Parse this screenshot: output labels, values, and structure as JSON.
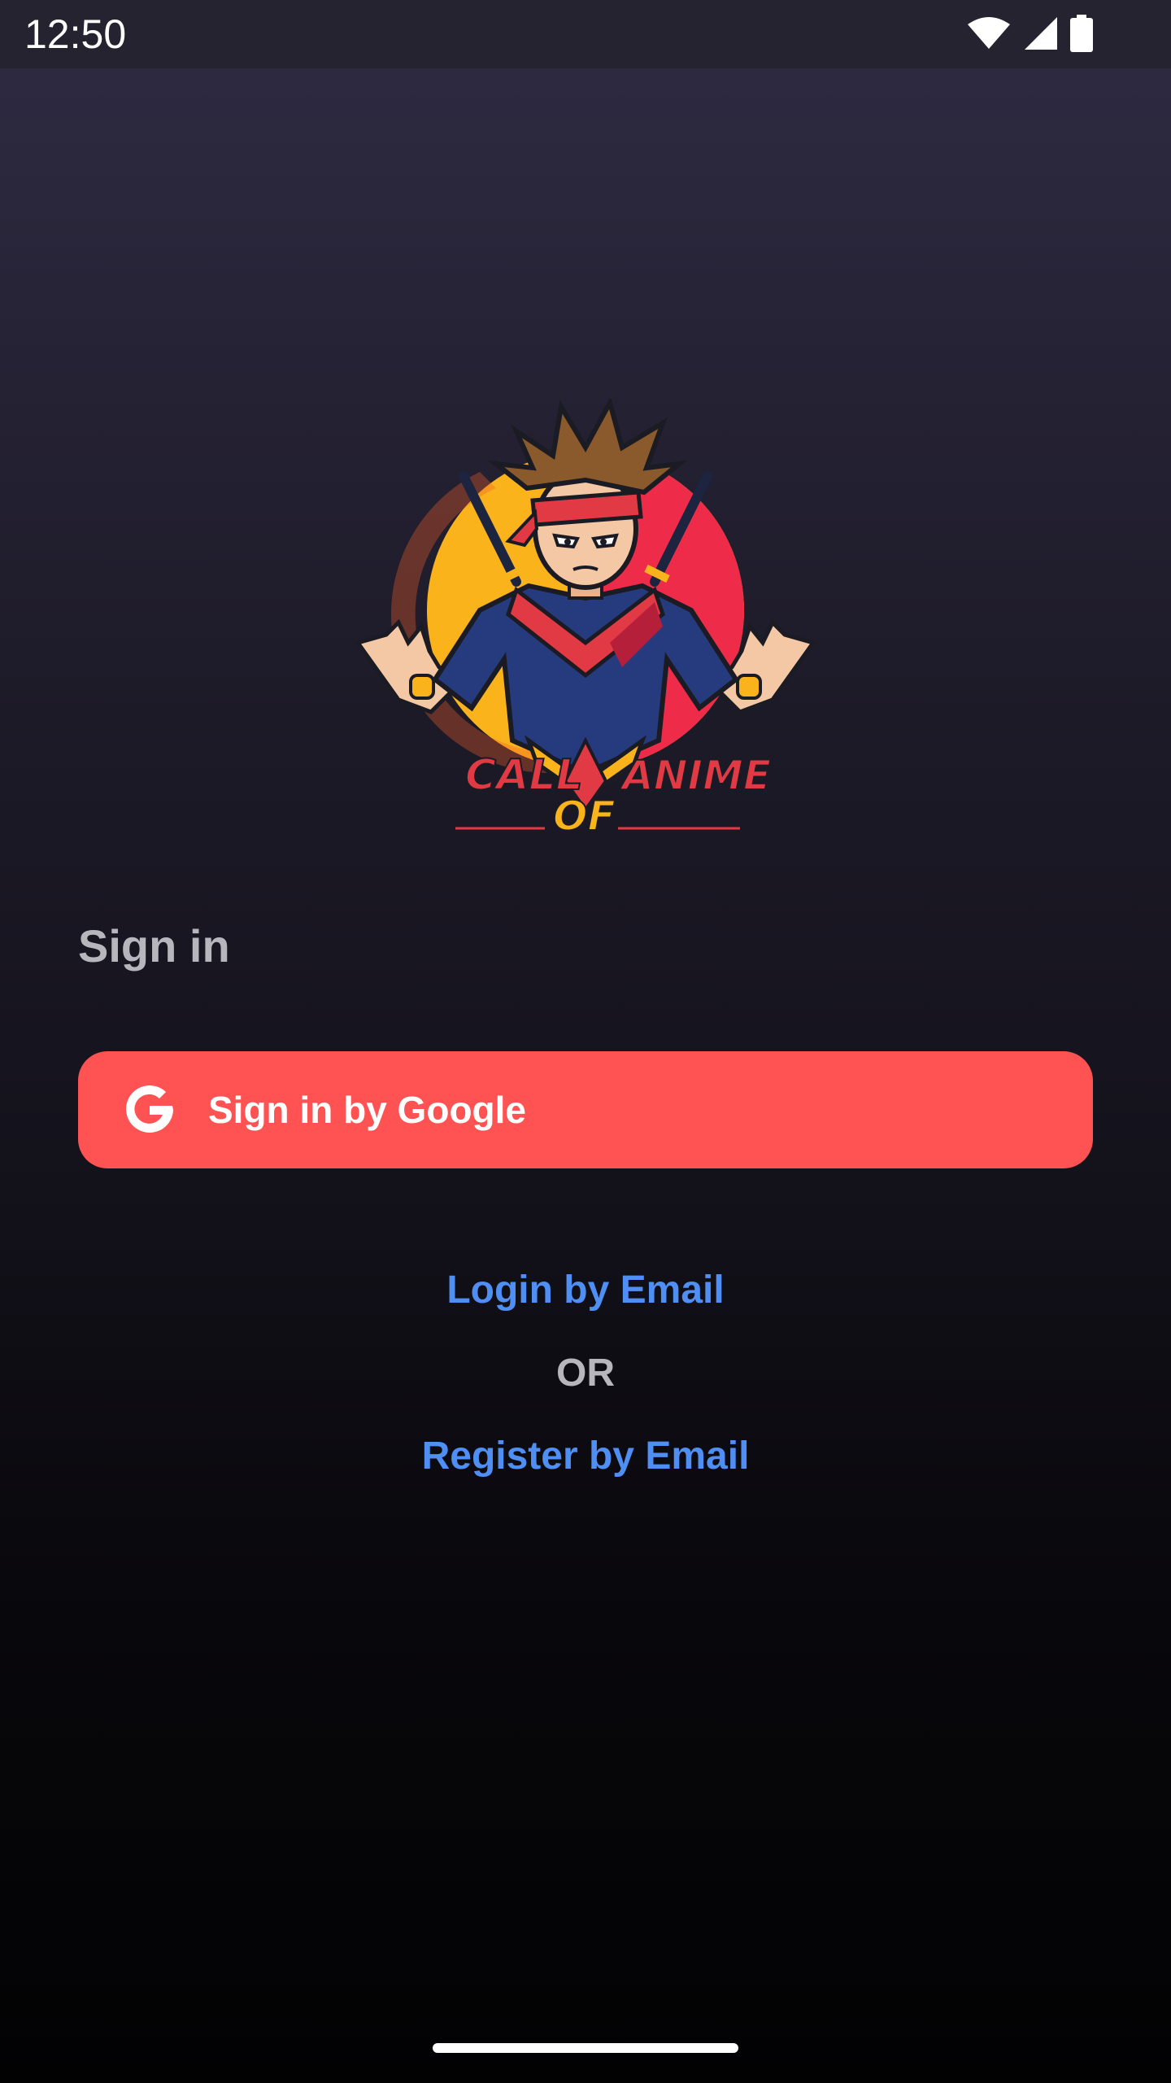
{
  "status_bar": {
    "time": "12:50",
    "icons": [
      "wifi-icon",
      "signal-icon",
      "battery-icon"
    ]
  },
  "logo": {
    "brand_text_top_left": "CALL",
    "brand_text_top_right": "ANIME",
    "brand_text_bottom": "OF",
    "colors": {
      "sun_yellow": "#fbb31c",
      "sun_red": "#ee2c49",
      "outfit_navy": "#263a7e",
      "headband_red": "#e23a45",
      "hair_brown": "#8a5a2c"
    }
  },
  "auth": {
    "heading": "Sign in",
    "google_button_label": "Sign in by Google",
    "login_link": "Login by Email",
    "separator": "OR",
    "register_link": "Register by Email"
  },
  "colors": {
    "accent_button": "#ff5252",
    "link": "#4f8ef2",
    "muted_text": "#b8b6bd",
    "status_bar": "#25232f"
  }
}
